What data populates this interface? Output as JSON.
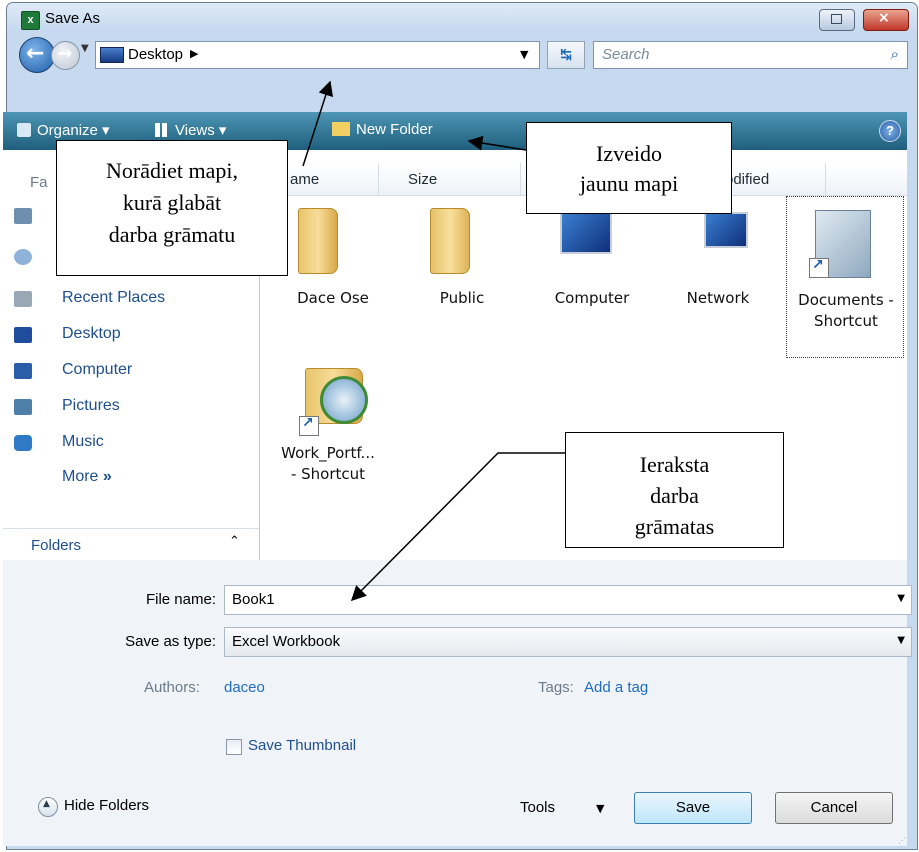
{
  "window": {
    "title": "Save As",
    "close": "×"
  },
  "nav": {
    "address": "Desktop",
    "search_placeholder": "Search"
  },
  "toolbar": {
    "organize": "Organize",
    "views": "Views",
    "new_folder": "New Folder",
    "help": "?"
  },
  "left_pane": {
    "favorites_label": "Fa",
    "items": [
      "Recent Places",
      "Desktop",
      "Computer",
      "Pictures",
      "Music"
    ],
    "more": "More",
    "more_glyph": "»",
    "folders": "Folders"
  },
  "columns": {
    "name": "ame",
    "size": "Size",
    "modified": "odified"
  },
  "files": [
    {
      "label": "Dace Ose",
      "icon": "folder-icon"
    },
    {
      "label": "Public",
      "icon": "folder-icon"
    },
    {
      "label": "Computer",
      "icon": "computer-icon"
    },
    {
      "label": "Network",
      "icon": "network-icon"
    },
    {
      "label1": "Documents -",
      "label2": "Shortcut",
      "icon": "documents-shortcut-icon"
    },
    {
      "label1": "Work_Portf...",
      "label2": "- Shortcut",
      "icon": "backup-shortcut-icon"
    }
  ],
  "form": {
    "file_name_label": "File name:",
    "file_name": "Book1",
    "save_type_label": "Save as type:",
    "save_type": "Excel Workbook",
    "authors_label": "Authors:",
    "authors": "daceo",
    "tags_label": "Tags:",
    "tags": "Add a tag",
    "thumbnail": "Save Thumbnail"
  },
  "footer": {
    "hide_folders": "Hide Folders",
    "tools": "Tools",
    "save": "Save",
    "cancel": "Cancel"
  },
  "callouts": {
    "folder_line1": "Norādiet mapi,",
    "folder_line2": "kurā glabāt",
    "folder_line3": "darba grāmatu",
    "newfolder_line1": "Izveido",
    "newfolder_line2": "jaunu mapi",
    "name_line1": "Ieraksta",
    "name_line2": "darba",
    "name_line3": "grāmatas"
  },
  "colors": {
    "titlebar": "#c6d9ef",
    "toolbar": "#2f7596",
    "link": "#1f4f8e",
    "close": "#c0382b"
  }
}
